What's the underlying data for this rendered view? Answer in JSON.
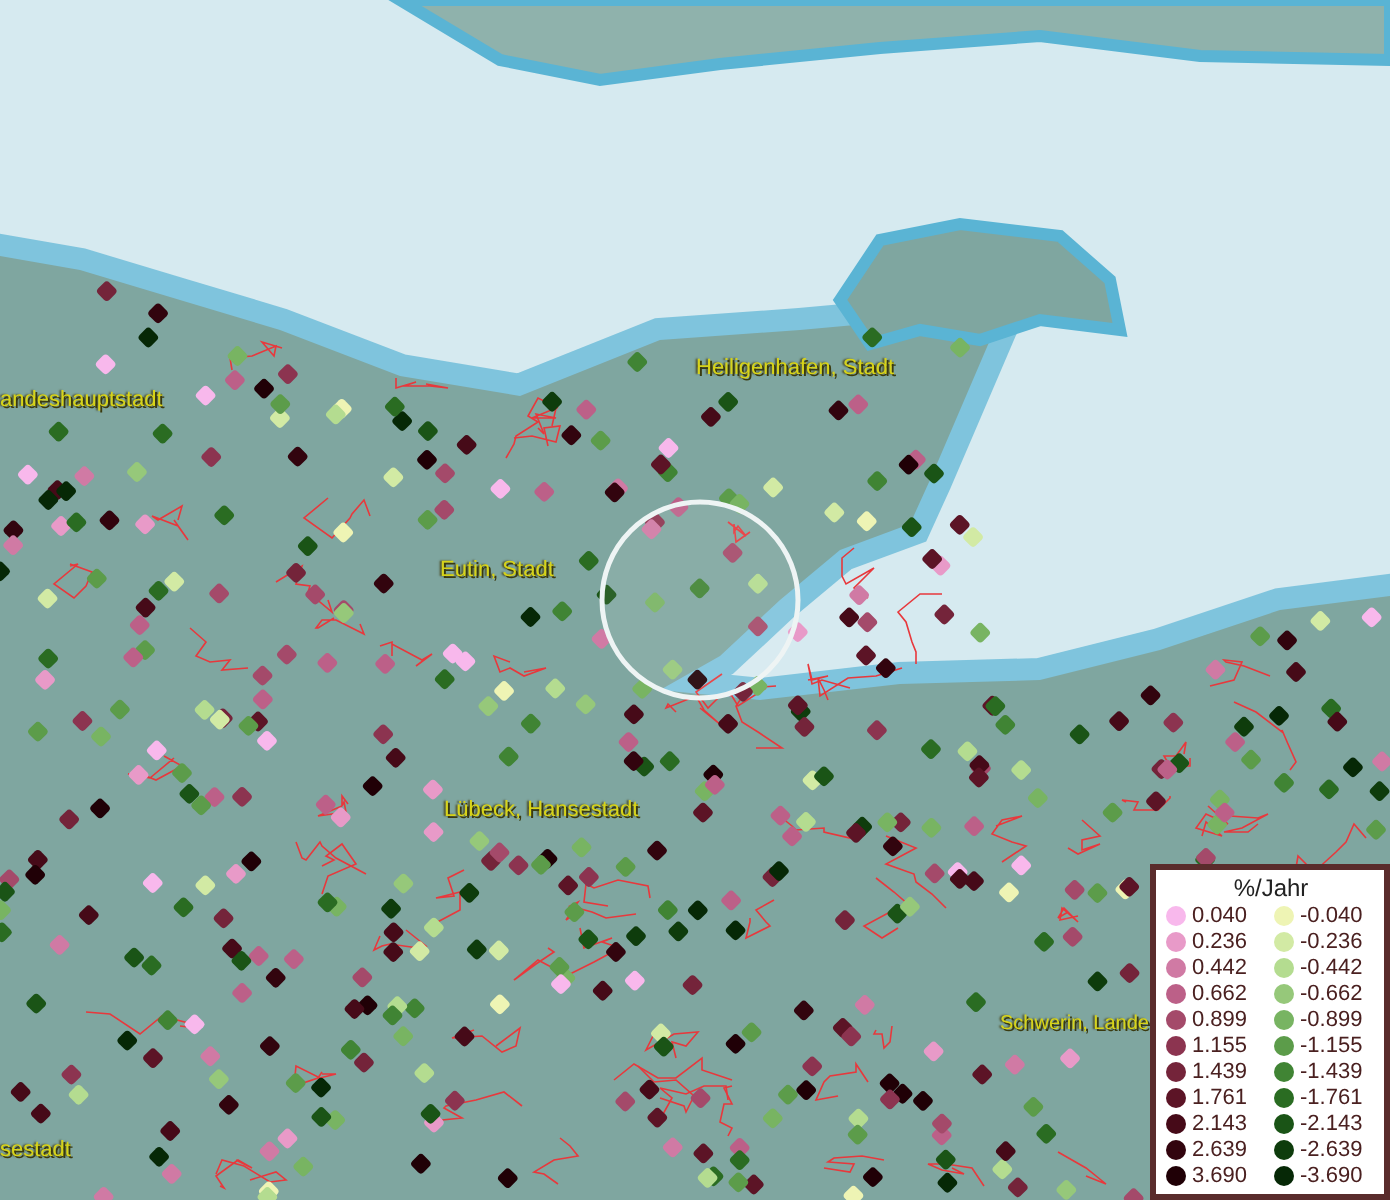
{
  "map": {
    "place_labels": [
      {
        "text": "Heiligenhafen, Stadt"
      },
      {
        "text": "andeshauptstadt"
      },
      {
        "text": "Eutin, Stadt"
      },
      {
        "text": "Lübeck, Hansestadt"
      },
      {
        "text": "Schwerin, Lande"
      },
      {
        "text": "sestadt"
      }
    ]
  },
  "legend": {
    "title": "%/Jahr",
    "rows": [
      {
        "left": {
          "label": "0.040",
          "color": "#f8b8ec"
        },
        "right": {
          "label": "-0.040",
          "color": "#eef4b4"
        }
      },
      {
        "left": {
          "label": "0.236",
          "color": "#e89ac8"
        },
        "right": {
          "label": "-0.236",
          "color": "#d2eaa4"
        }
      },
      {
        "left": {
          "label": "0.442",
          "color": "#d07aa4"
        },
        "right": {
          "label": "-0.442",
          "color": "#b4dc90"
        }
      },
      {
        "left": {
          "label": "0.662",
          "color": "#bc6088"
        },
        "right": {
          "label": "-0.662",
          "color": "#96c87a"
        }
      },
      {
        "left": {
          "label": "0.899",
          "color": "#a44a6a"
        },
        "right": {
          "label": "-0.899",
          "color": "#78b462"
        }
      },
      {
        "left": {
          "label": "1.155",
          "color": "#8c3450"
        },
        "right": {
          "label": "-1.155",
          "color": "#5c9c4a"
        }
      },
      {
        "left": {
          "label": "1.439",
          "color": "#74243a"
        },
        "right": {
          "label": "-1.439",
          "color": "#408434"
        }
      },
      {
        "left": {
          "label": "1.761",
          "color": "#5c1426"
        },
        "right": {
          "label": "-1.761",
          "color": "#2a6c22"
        }
      },
      {
        "left": {
          "label": "2.143",
          "color": "#460a18"
        },
        "right": {
          "label": "-2.143",
          "color": "#1a5416"
        }
      },
      {
        "left": {
          "label": "2.639",
          "color": "#32040e"
        },
        "right": {
          "label": "-2.639",
          "color": "#0e3c0c"
        }
      },
      {
        "left": {
          "label": "3.690",
          "color": "#200006"
        },
        "right": {
          "label": "-3.690",
          "color": "#062806"
        }
      }
    ]
  }
}
